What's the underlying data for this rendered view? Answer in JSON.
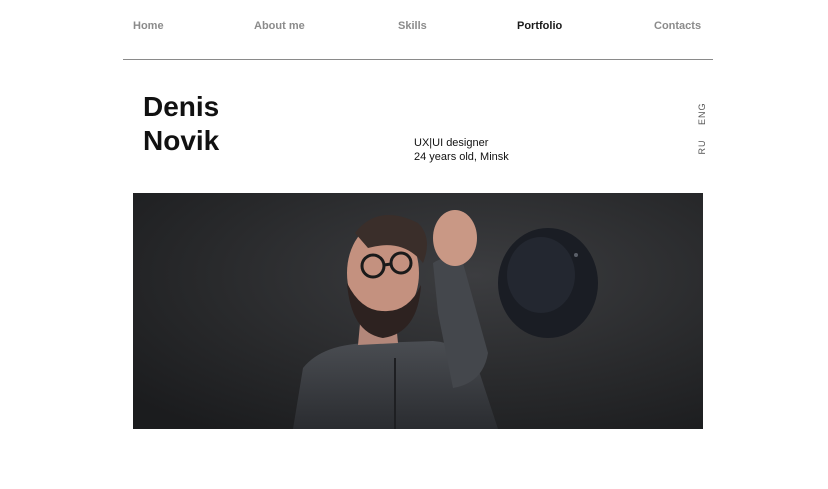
{
  "nav": {
    "home": "Home",
    "about": "About me",
    "skills": "Skills",
    "portfolio": "Portfolio",
    "contacts": "Contacts"
  },
  "profile": {
    "first_name": "Denis",
    "last_name": "Novik",
    "role": "UX|UI designer",
    "details": "24 years old, Minsk"
  },
  "language": {
    "eng": "ENG",
    "ru": "RU"
  },
  "hero_image": {
    "icon": "portrait-photo",
    "background_color": "#2a2b2d"
  },
  "colors": {
    "nav_inactive": "#8b8b8b",
    "nav_active": "#1a1a1a",
    "divider": "#8a8a8a"
  }
}
